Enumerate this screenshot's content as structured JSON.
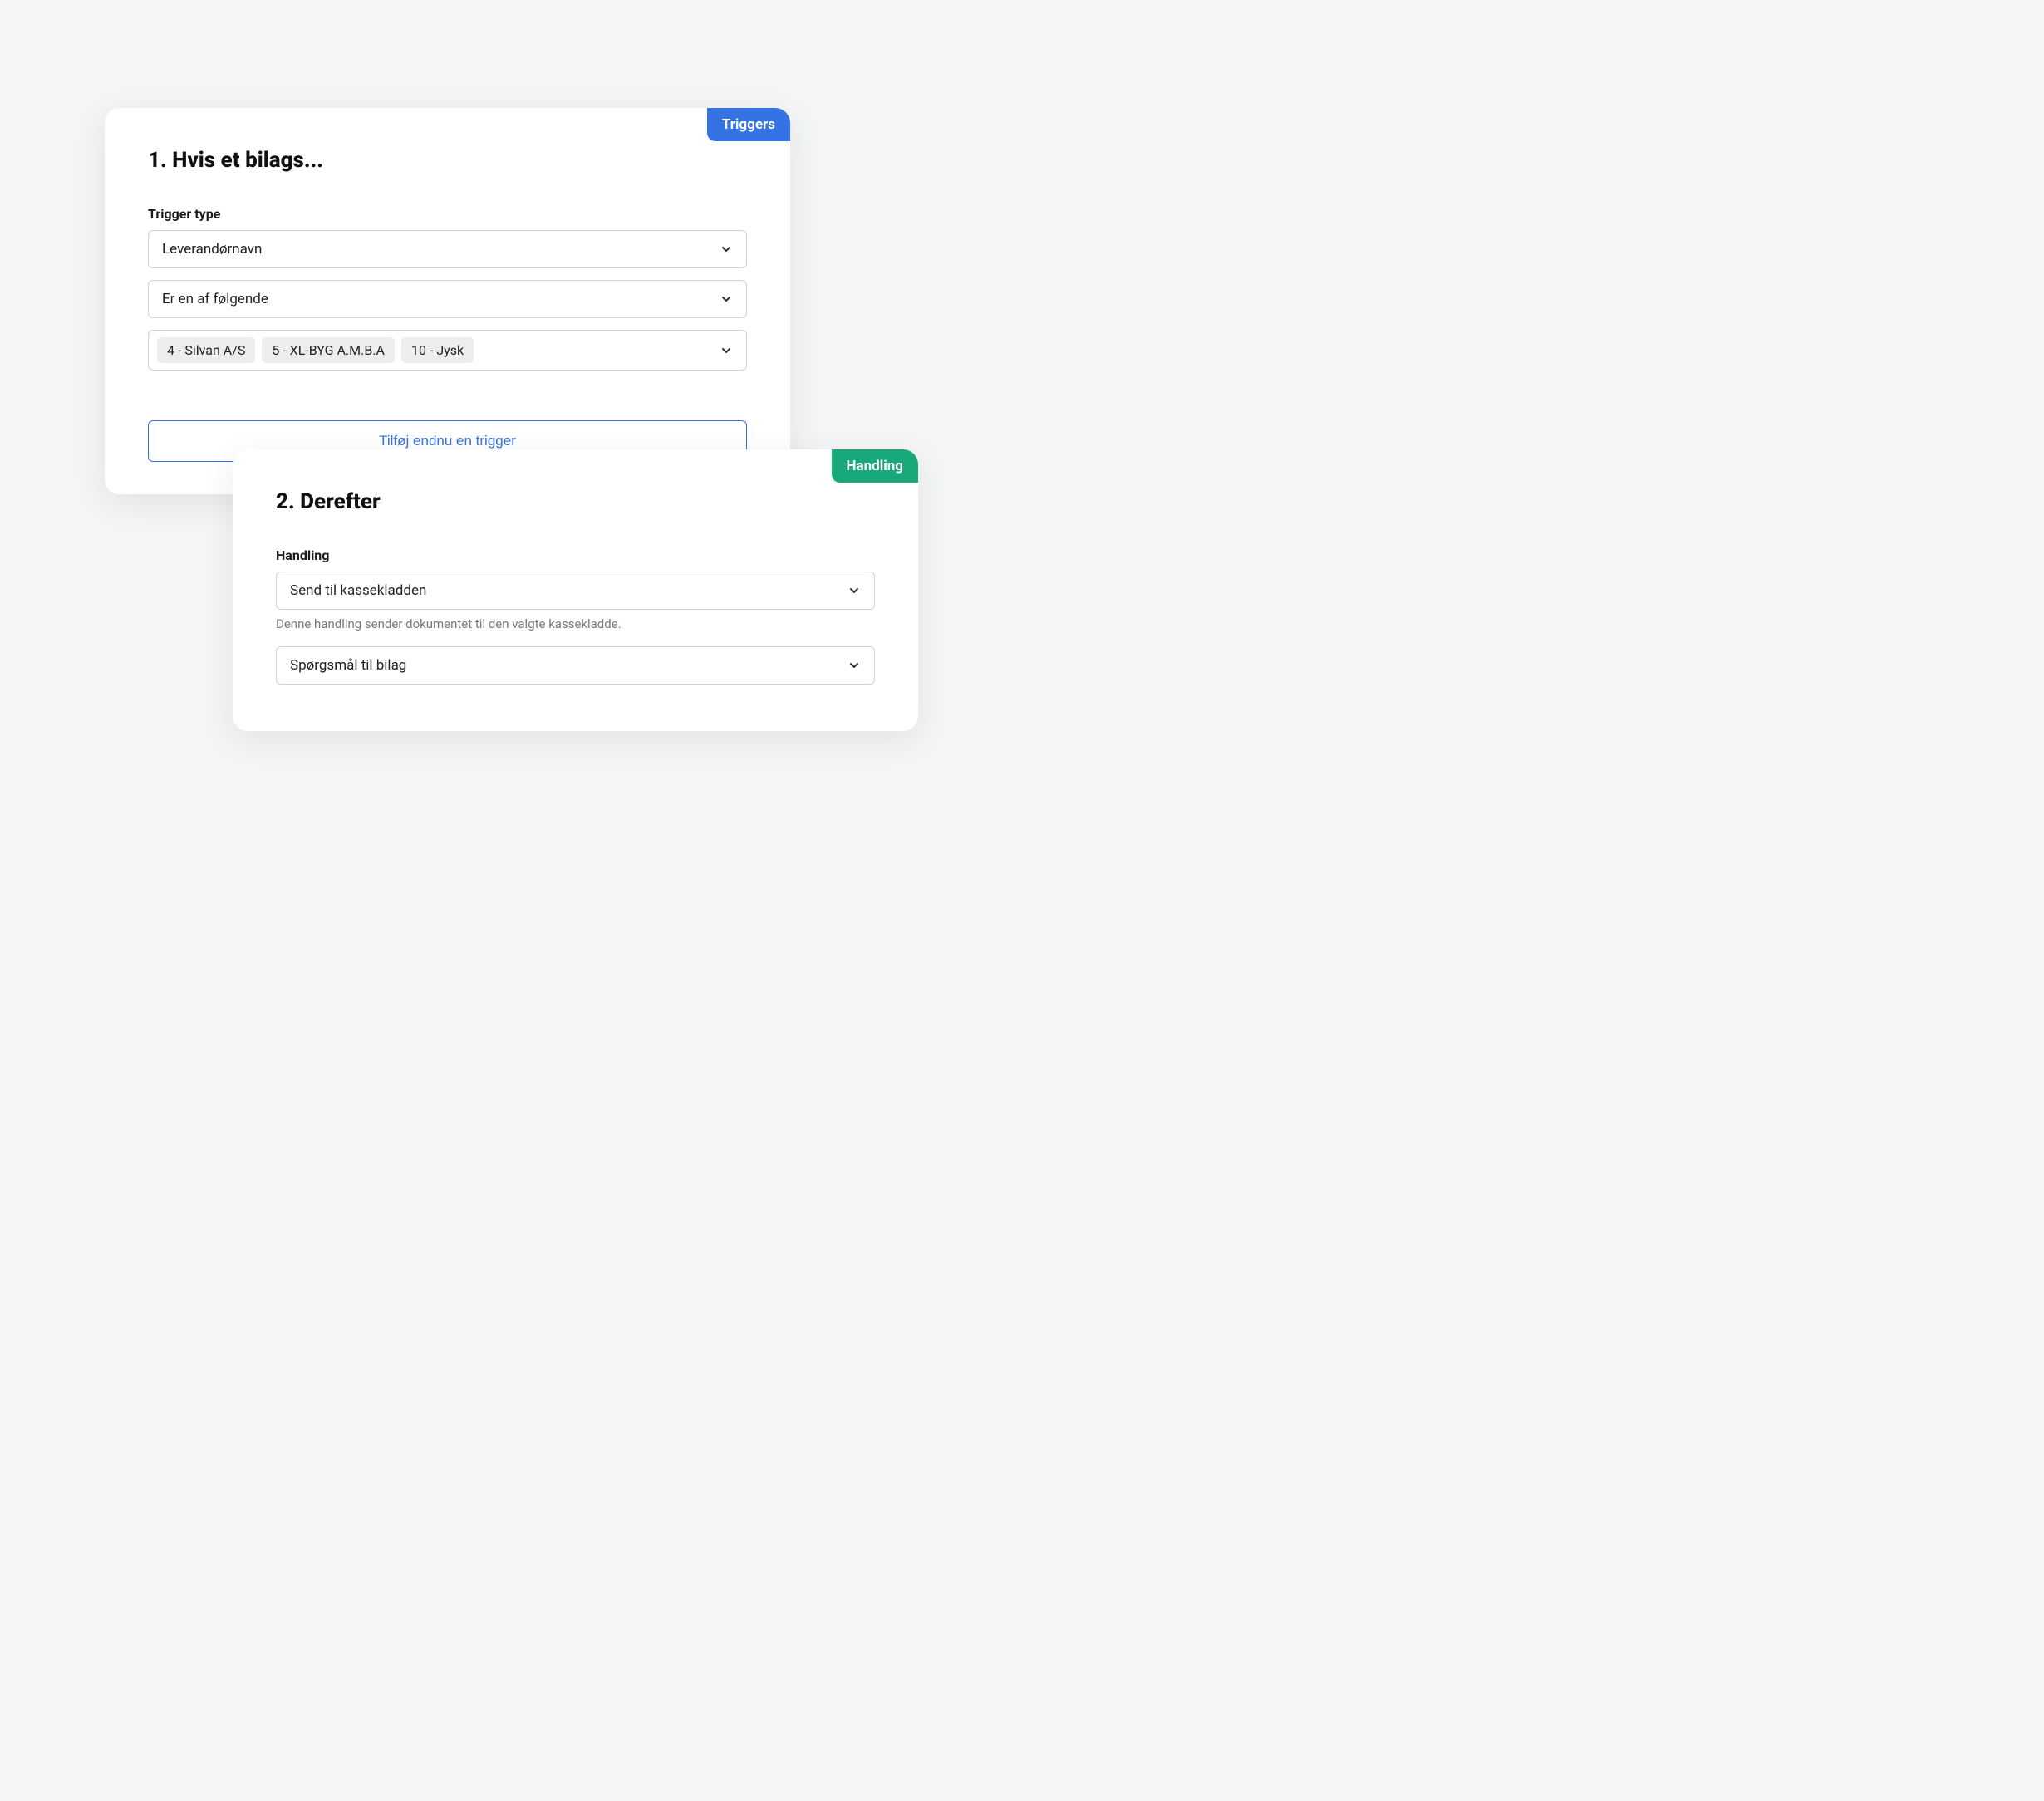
{
  "triggers_card": {
    "tag_label": "Triggers",
    "title": "1. Hvis et bilags...",
    "trigger_type_label": "Trigger type",
    "trigger_type_value": "Leverandørnavn",
    "condition_value": "Er en af følgende",
    "chips": [
      "4 - Silvan A/S",
      "5 - XL-BYG A.M.B.A",
      "10 - Jysk"
    ],
    "add_trigger_label": "Tilføj endnu en trigger"
  },
  "handling_card": {
    "tag_label": "Handling",
    "title": "2. Derefter",
    "handling_label": "Handling",
    "handling_value": "Send til kassekladden",
    "handling_help": "Denne handling sender dokumentet til den valgte kassekladde.",
    "target_value": "Spørgsmål til bilag"
  }
}
